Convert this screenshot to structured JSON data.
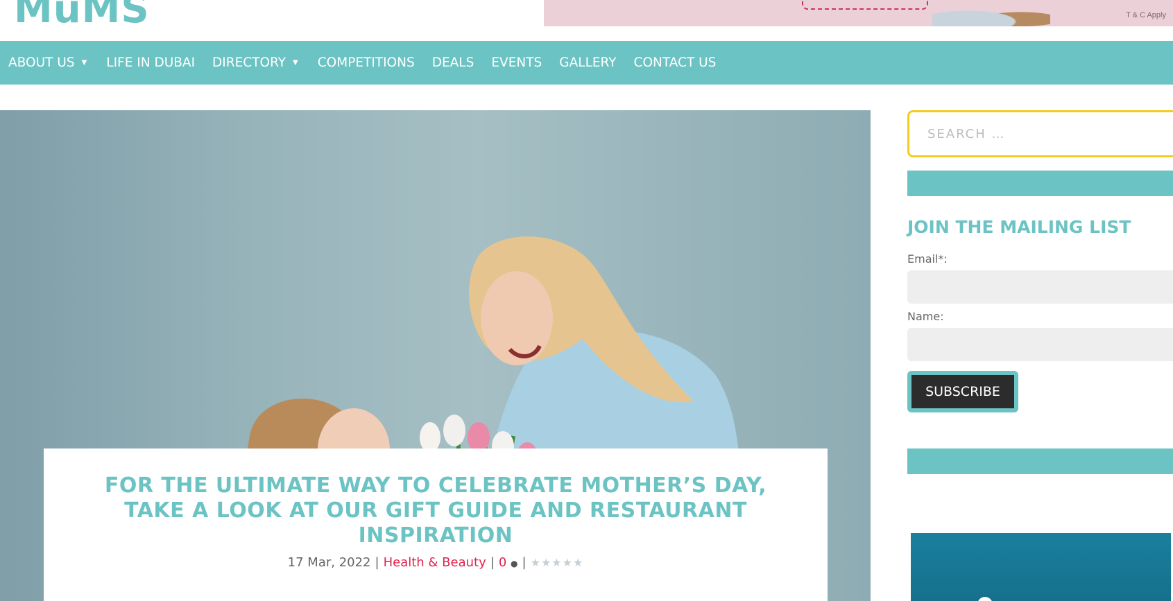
{
  "site": {
    "logo_text": "MuMS",
    "banner_tc": "T & C Apply"
  },
  "nav": {
    "items": [
      {
        "label": "ABOUT US",
        "has_dropdown": true
      },
      {
        "label": "LIFE IN DUBAI",
        "has_dropdown": false
      },
      {
        "label": "DIRECTORY",
        "has_dropdown": true
      },
      {
        "label": "COMPETITIONS",
        "has_dropdown": false
      },
      {
        "label": "DEALS",
        "has_dropdown": false
      },
      {
        "label": "EVENTS",
        "has_dropdown": false
      },
      {
        "label": "GALLERY",
        "has_dropdown": false
      },
      {
        "label": "CONTACT US",
        "has_dropdown": false
      }
    ],
    "caret": "▼"
  },
  "post": {
    "title": "FOR THE ULTIMATE WAY TO CELEBRATE MOTHER’S DAY, TAKE A LOOK AT OUR GIFT GUIDE AND RESTAURANT INSPIRATION",
    "date": "17 Mar, 2022",
    "separator": "|",
    "category": "Health & Beauty",
    "comments": "0",
    "rating_stars": "★★★★★",
    "rating": 0
  },
  "sidebar": {
    "search_placeholder": "SEARCH …",
    "mailing_title": "JOIN THE MAILING LIST",
    "email_label": "Email*:",
    "name_label": "Name:",
    "email_value": "",
    "name_value": "",
    "subscribe_label": "SUBSCRIBE"
  },
  "colors": {
    "brand_teal": "#6cc3c4",
    "accent_red": "#e0234a",
    "search_border": "#f5cc1b"
  }
}
